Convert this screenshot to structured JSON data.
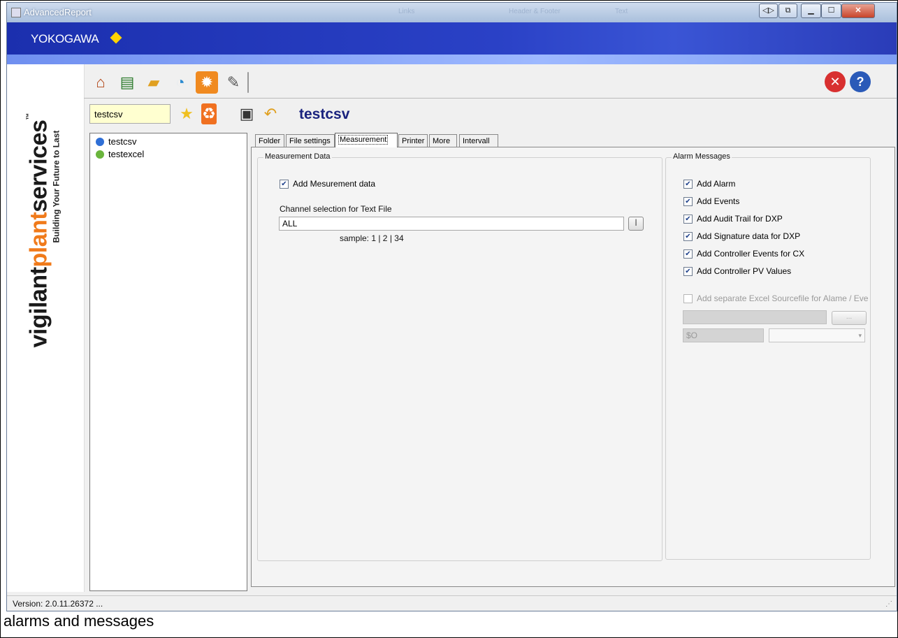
{
  "window": {
    "title": "AdvancedReport",
    "ghost_tabs": [
      "Links",
      "Header & Footer",
      "Text"
    ]
  },
  "banner": {
    "brand": "YOKOGAWA"
  },
  "sidebar_brand": {
    "part1": "vigilant",
    "part2": "plant",
    "part3": "services",
    "tm": "™",
    "tagline": "Building Your Future to Last"
  },
  "toolbar": {
    "icons": [
      "home-icon",
      "new-report-icon",
      "folder-icon",
      "schedule-icon",
      "settings-icon",
      "edit-icon",
      "exit-icon",
      "help-icon"
    ]
  },
  "report_bar": {
    "name_value": "testcsv",
    "heading": "testcsv",
    "icons": [
      "add-star-icon",
      "delete-icon",
      "save-icon",
      "undo-icon"
    ]
  },
  "tree": {
    "items": [
      {
        "label": "testcsv",
        "color": "#2f6fd6"
      },
      {
        "label": "testexcel",
        "color": "#6ab53c"
      }
    ]
  },
  "tabs": [
    {
      "label": "Folder"
    },
    {
      "label": "File settings"
    },
    {
      "label": "Measurement",
      "active": true
    },
    {
      "label": "Printer"
    },
    {
      "label": "More"
    },
    {
      "label": "Intervall"
    }
  ],
  "measurement": {
    "legend": "Measurement Data",
    "add_label": "Add Mesurement data",
    "add_checked": true,
    "channel_label": "Channel selection for Text File",
    "channel_value": "ALL",
    "channel_button": "|",
    "sample": "sample: 1 | 2 | 34"
  },
  "alarms": {
    "legend": "Alarm Messages",
    "checks": [
      {
        "label": "Add Alarm",
        "checked": true
      },
      {
        "label": "Add Events",
        "checked": true
      },
      {
        "label": "Add Audit Trail for DXP",
        "checked": true
      },
      {
        "label": "Add Signature data for DXP",
        "checked": true
      },
      {
        "label": "Add Controller Events for CX",
        "checked": true
      },
      {
        "label": "Add Controller PV Values",
        "checked": true
      }
    ],
    "separate_label": "Add separate Excel Sourcefile for Alame / Eve",
    "separate_checked": false,
    "browse_button": "...",
    "sheet_value": "$O"
  },
  "status": {
    "version": "Version: 2.0.11.26372  ..."
  },
  "caption": "alarms and messages"
}
